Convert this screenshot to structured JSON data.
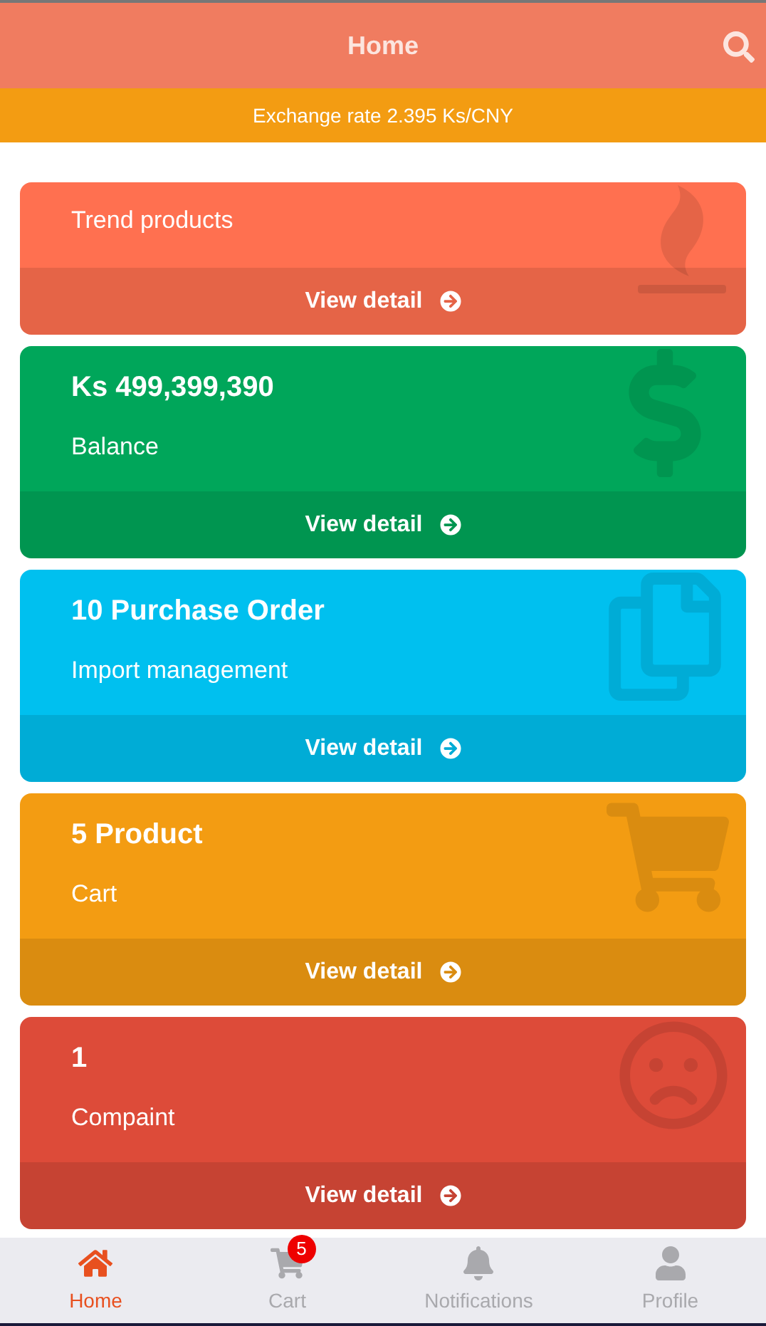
{
  "header": {
    "title": "Home"
  },
  "exchange_rate": "Exchange rate 2.395 Ks/CNY",
  "cards": [
    {
      "kind": "trend",
      "color": "#ff7050",
      "title": "Trend products",
      "action": "View detail"
    },
    {
      "kind": "balance",
      "color": "#00a65a",
      "title": "Ks 499,399,390",
      "subtitle": "Balance",
      "action": "View detail"
    },
    {
      "kind": "orders",
      "color": "#00c0ef",
      "title": "10 Purchase Order",
      "subtitle": "Import management",
      "action": "View detail"
    },
    {
      "kind": "cart",
      "color": "#f39c12",
      "title": "5 Product",
      "subtitle": "Cart",
      "action": "View detail"
    },
    {
      "kind": "complaint",
      "color": "#dd4b39",
      "title": "1",
      "subtitle": "Compaint",
      "action": "View detail"
    }
  ],
  "nav": [
    {
      "kind": "home",
      "label": "Home",
      "selected": true
    },
    {
      "kind": "cart",
      "label": "Cart",
      "selected": false,
      "badge": "5"
    },
    {
      "kind": "bell",
      "label": "Notifications",
      "selected": false
    },
    {
      "kind": "person",
      "label": "Profile",
      "selected": false
    }
  ]
}
